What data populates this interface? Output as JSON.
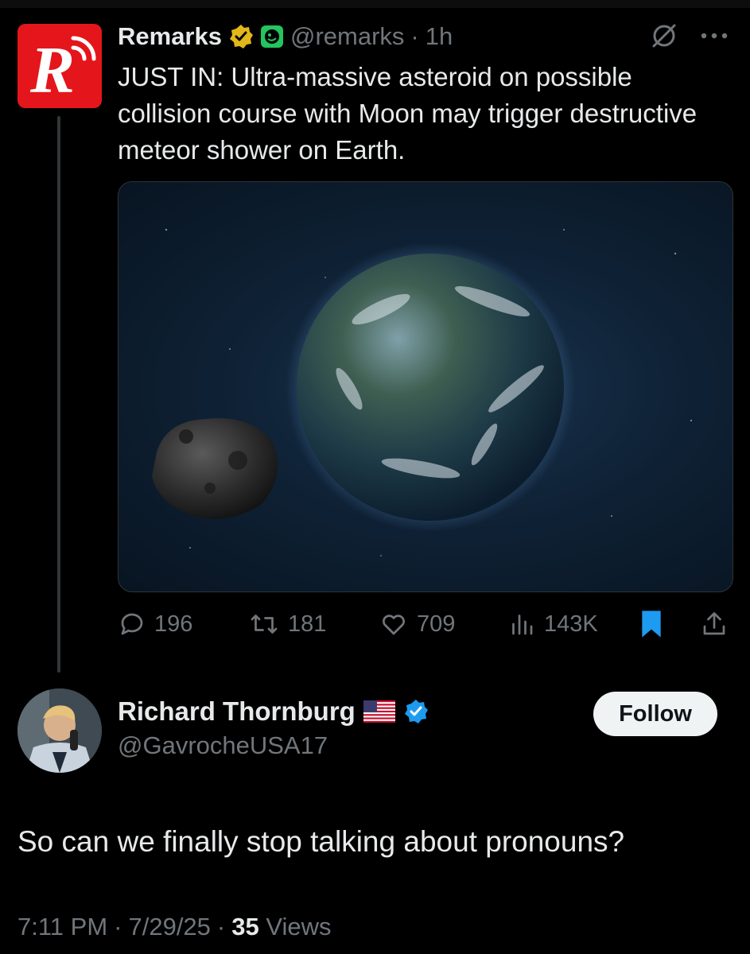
{
  "parent_tweet": {
    "avatar_letter": "R",
    "name": "Remarks",
    "handle": "@remarks",
    "separator": "·",
    "time": "1h",
    "text": "JUST IN: Ultra-massive asteroid on possible collision course with Moon may trigger destructive meteor shower on Earth.",
    "media_icons": [
      "asteroid",
      "earth"
    ],
    "actions": {
      "replies": "196",
      "reposts": "181",
      "likes": "709",
      "views": "143K"
    },
    "colors": {
      "brand_red": "#e4161b",
      "gold_badge": "#e2b719",
      "bookmark_blue": "#1d9bf0"
    }
  },
  "tweet": {
    "name": "Richard Thornburg",
    "handle": "@GavrocheUSA17",
    "follow_label": "Follow",
    "text": "So can we finally stop talking about pronouns?",
    "time": "7:11 PM",
    "date": "7/29/25",
    "separator": "·",
    "views_count": "35",
    "views_label": "Views"
  }
}
